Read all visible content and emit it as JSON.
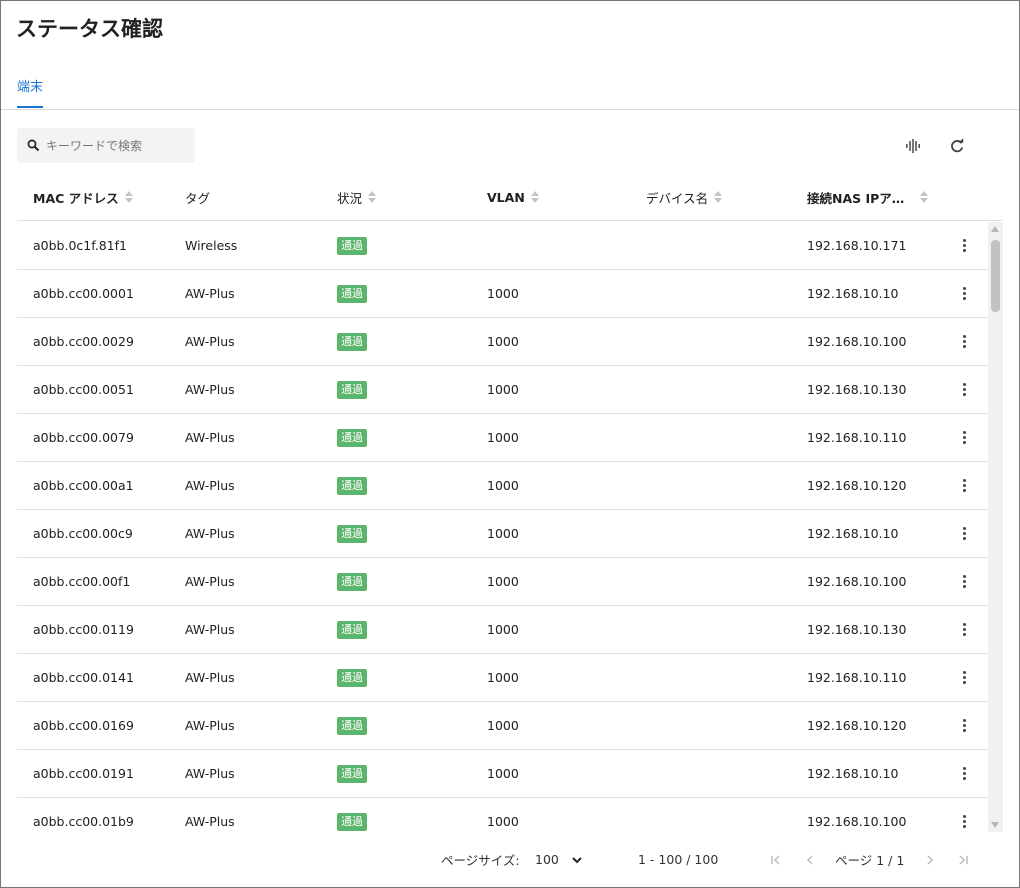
{
  "page": {
    "title": "ステータス確認"
  },
  "tabs": [
    {
      "label": "端末"
    }
  ],
  "search": {
    "placeholder": "キーワードで検索",
    "value": ""
  },
  "toolbar": {
    "density_icon": "density-icon",
    "refresh_icon": "refresh-icon"
  },
  "table": {
    "columns": [
      {
        "label": "MAC アドレス",
        "sortable": true
      },
      {
        "label": "タグ",
        "sortable": false
      },
      {
        "label": "状況",
        "sortable": true
      },
      {
        "label": "VLAN",
        "sortable": true
      },
      {
        "label": "デバイス名",
        "sortable": true
      },
      {
        "label": "接続NAS IPア…",
        "sortable": true
      }
    ],
    "rows": [
      {
        "mac": "a0bb.0c1f.81f1",
        "tag": "Wireless",
        "status": "通過",
        "vlan": "",
        "device": "",
        "nas_ip": "192.168.10.171"
      },
      {
        "mac": "a0bb.cc00.0001",
        "tag": "AW-Plus",
        "status": "通過",
        "vlan": "1000",
        "device": "",
        "nas_ip": "192.168.10.10"
      },
      {
        "mac": "a0bb.cc00.0029",
        "tag": "AW-Plus",
        "status": "通過",
        "vlan": "1000",
        "device": "",
        "nas_ip": "192.168.10.100"
      },
      {
        "mac": "a0bb.cc00.0051",
        "tag": "AW-Plus",
        "status": "通過",
        "vlan": "1000",
        "device": "",
        "nas_ip": "192.168.10.130"
      },
      {
        "mac": "a0bb.cc00.0079",
        "tag": "AW-Plus",
        "status": "通過",
        "vlan": "1000",
        "device": "",
        "nas_ip": "192.168.10.110"
      },
      {
        "mac": "a0bb.cc00.00a1",
        "tag": "AW-Plus",
        "status": "通過",
        "vlan": "1000",
        "device": "",
        "nas_ip": "192.168.10.120"
      },
      {
        "mac": "a0bb.cc00.00c9",
        "tag": "AW-Plus",
        "status": "通過",
        "vlan": "1000",
        "device": "",
        "nas_ip": "192.168.10.10"
      },
      {
        "mac": "a0bb.cc00.00f1",
        "tag": "AW-Plus",
        "status": "通過",
        "vlan": "1000",
        "device": "",
        "nas_ip": "192.168.10.100"
      },
      {
        "mac": "a0bb.cc00.0119",
        "tag": "AW-Plus",
        "status": "通過",
        "vlan": "1000",
        "device": "",
        "nas_ip": "192.168.10.130"
      },
      {
        "mac": "a0bb.cc00.0141",
        "tag": "AW-Plus",
        "status": "通過",
        "vlan": "1000",
        "device": "",
        "nas_ip": "192.168.10.110"
      },
      {
        "mac": "a0bb.cc00.0169",
        "tag": "AW-Plus",
        "status": "通過",
        "vlan": "1000",
        "device": "",
        "nas_ip": "192.168.10.120"
      },
      {
        "mac": "a0bb.cc00.0191",
        "tag": "AW-Plus",
        "status": "通過",
        "vlan": "1000",
        "device": "",
        "nas_ip": "192.168.10.10"
      },
      {
        "mac": "a0bb.cc00.01b9",
        "tag": "AW-Plus",
        "status": "通過",
        "vlan": "1000",
        "device": "",
        "nas_ip": "192.168.10.100"
      }
    ]
  },
  "footer": {
    "page_size_label": "ページサイズ:",
    "page_size_value": "100",
    "page_size_options": [
      "100"
    ],
    "range": "1 - 100 / 100",
    "page_label": "ページ 1 / 1"
  },
  "colors": {
    "accent": "#1976d2",
    "badge_green": "#5bb56a"
  }
}
